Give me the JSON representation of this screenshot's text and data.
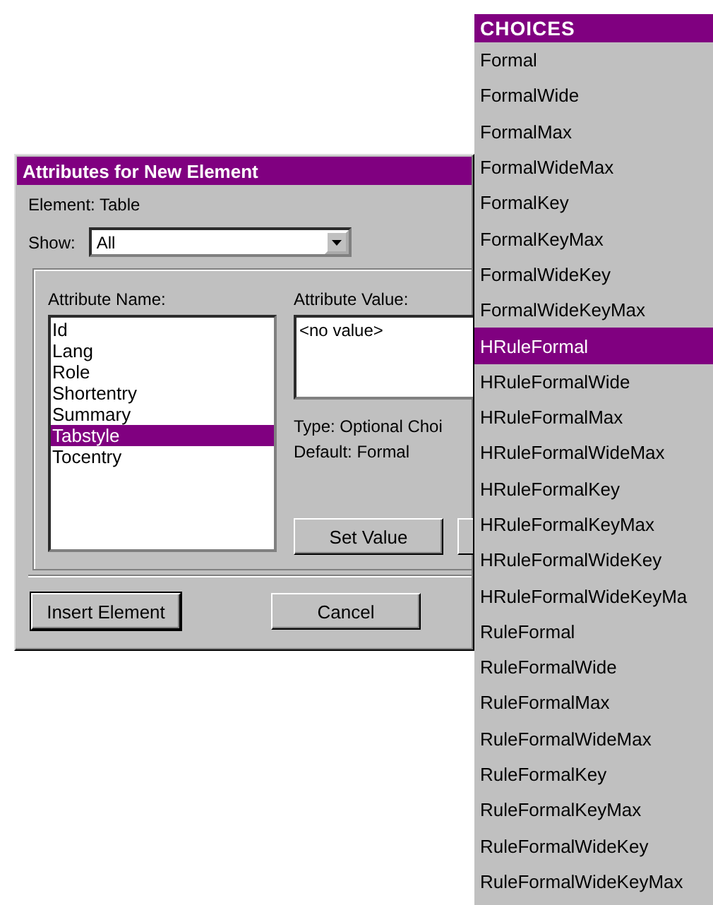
{
  "dialog": {
    "title": "Attributes for New Element",
    "element_line": "Element: Table",
    "show": {
      "label": "Show:",
      "value": "All"
    },
    "attribute_name": {
      "label": "Attribute Name:",
      "items": [
        {
          "label": "Id",
          "selected": false
        },
        {
          "label": "Lang",
          "selected": false
        },
        {
          "label": "Role",
          "selected": false
        },
        {
          "label": "Shortentry",
          "selected": false
        },
        {
          "label": "Summary",
          "selected": false
        },
        {
          "label": "Tabstyle",
          "selected": true
        },
        {
          "label": "Tocentry",
          "selected": false
        }
      ]
    },
    "attribute_value": {
      "label": "Attribute Value:",
      "value": "<no value>",
      "type_line": "Type: Optional Choi",
      "default_line": "Default: Formal"
    },
    "set_value_button": "Set Value",
    "buttons": [
      "Insert Element",
      "Cancel"
    ]
  },
  "choices": {
    "title": "CHOICES",
    "items": [
      {
        "label": "Formal",
        "selected": false
      },
      {
        "label": "FormalWide",
        "selected": false
      },
      {
        "label": "FormalMax",
        "selected": false
      },
      {
        "label": "FormalWideMax",
        "selected": false
      },
      {
        "label": "FormalKey",
        "selected": false
      },
      {
        "label": "FormalKeyMax",
        "selected": false
      },
      {
        "label": "FormalWideKey",
        "selected": false
      },
      {
        "label": "FormalWideKeyMax",
        "selected": false
      },
      {
        "label": "HRuleFormal",
        "selected": true
      },
      {
        "label": "HRuleFormalWide",
        "selected": false
      },
      {
        "label": "HRuleFormalMax",
        "selected": false
      },
      {
        "label": "HRuleFormalWideMax",
        "selected": false
      },
      {
        "label": "HRuleFormalKey",
        "selected": false
      },
      {
        "label": "HRuleFormalKeyMax",
        "selected": false
      },
      {
        "label": "HRuleFormalWideKey",
        "selected": false
      },
      {
        "label": "HRuleFormalWideKeyMa",
        "selected": false
      },
      {
        "label": "RuleFormal",
        "selected": false
      },
      {
        "label": "RuleFormalWide",
        "selected": false
      },
      {
        "label": "RuleFormalMax",
        "selected": false
      },
      {
        "label": "RuleFormalWideMax",
        "selected": false
      },
      {
        "label": "RuleFormalKey",
        "selected": false
      },
      {
        "label": "RuleFormalKeyMax",
        "selected": false
      },
      {
        "label": "RuleFormalWideKey",
        "selected": false
      },
      {
        "label": "RuleFormalWideKeyMax",
        "selected": false
      }
    ]
  }
}
